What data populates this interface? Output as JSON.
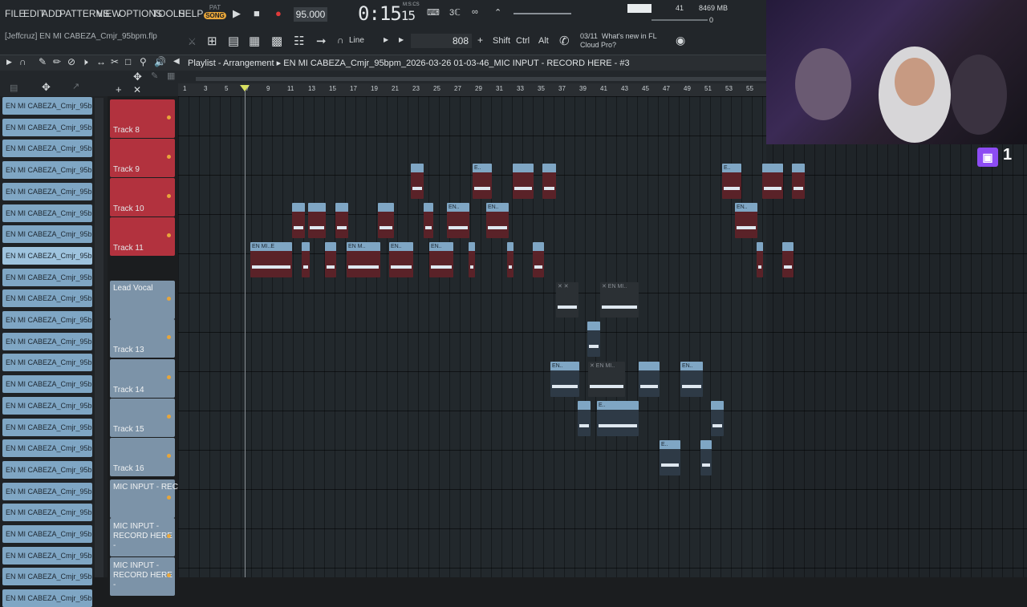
{
  "menu": [
    "FILE",
    "EDIT",
    "ADD",
    "PATTERNS",
    "VIEW",
    "OPTIONS",
    "TOOLS",
    "HELP"
  ],
  "transport": {
    "pat_label": "PAT",
    "song_label": "SONG",
    "tempo": "95.000",
    "time_main": "0:15",
    "time_sub": "15",
    "time_units": "M:S:CS",
    "meter_value": "41",
    "memory": "8469 MB",
    "cpu": "0"
  },
  "hint": "[Jeffcruz] EN MI CABEZA_Cmjr_95bpm.flp",
  "snap": "Line",
  "value": "808",
  "keys": [
    "Shift",
    "Ctrl",
    "Alt"
  ],
  "news": {
    "date": "03/11",
    "text_line1": "What's new in FL",
    "text_line2": "Cloud Pro?"
  },
  "playlist": {
    "label": "Playlist - Arrangement",
    "title": "EN MI CABEZA_Cmjr_95bpm_2026-03-26 01-03-46_MIC INPUT - RECORD HERE - #3"
  },
  "ruler": [
    "1",
    "3",
    "5",
    "7",
    "9",
    "11",
    "13",
    "15",
    "17",
    "19",
    "21",
    "23",
    "25",
    "27",
    "29",
    "31",
    "33",
    "35",
    "37",
    "39",
    "41",
    "43",
    "45",
    "47",
    "49",
    "51",
    "53",
    "55"
  ],
  "patterns": [
    "EN MI CABEZA_Cmjr_95bp...",
    "EN MI CABEZA_Cmjr_95bp...",
    "EN MI CABEZA_Cmjr_95bp...",
    "EN MI CABEZA_Cmjr_95bp...",
    "EN MI CABEZA_Cmjr_95bp...",
    "EN MI CABEZA_Cmjr_95bp...",
    "EN MI CABEZA_Cmjr_95bp...",
    "EN MI CABEZA_Cmjr_95bp...",
    "EN MI CABEZA_Cmjr_95bp...",
    "EN MI CABEZA_Cmjr_95bp...",
    "EN MI CABEZA_Cmjr_95bp...",
    "EN MI CABEZA_Cmjr_95bp...",
    "EN MI CABEZA_Cmjr_95bp...",
    "EN MI CABEZA_Cmjr_95bp...",
    "EN MI CABEZA_Cmjr_95bp...",
    "EN MI CABEZA_Cmjr_95bp...",
    "EN MI CABEZA_Cmjr_95bp...",
    "EN MI CABEZA_Cmjr_95bp...",
    "EN MI CABEZA_Cmjr_95bp...",
    "EN MI CABEZA_Cmjr_95bp...",
    "EN MI CABEZA_Cmjr_95bp...",
    "EN MI CABEZA_Cmjr_95bp...",
    "EN MI CABEZA_Cmjr_95bp...",
    "EN MI CABEZA_Cmjr_95bp..."
  ],
  "tracks": [
    "Track 8",
    "Track 9",
    "Track 10",
    "Track 11",
    "Lead Vocal",
    "Track 13",
    "Track 14",
    "Track 15",
    "Track 16",
    "MIC INPUT - REC...",
    "MIC INPUT - RECORD HERE -",
    "MIC INPUT - RECORD HERE -"
  ],
  "clip_labels": {
    "en_mi_e": "EN MI..E",
    "en_m": "EN M..",
    "en": "EN..",
    "en_mi": "EN MI..",
    "x_en_mi": "✕ EN MI..",
    "e": "E..",
    "xx": "✕ ✕"
  },
  "twitch": {
    "count": "1"
  }
}
